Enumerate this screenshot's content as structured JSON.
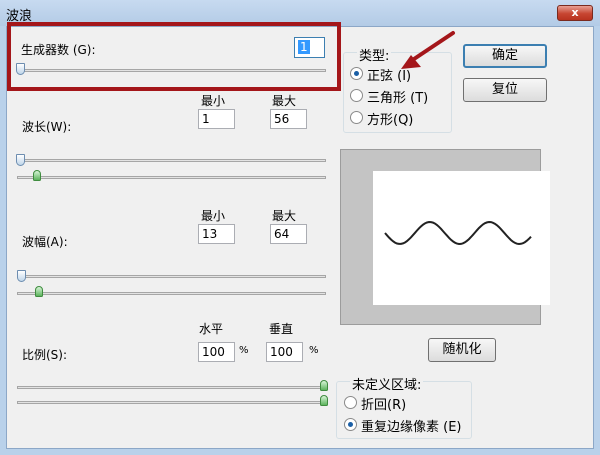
{
  "window": {
    "title": "波浪",
    "close_label": "x"
  },
  "generators": {
    "label": "生成器数 (G):",
    "value": "1"
  },
  "headers": {
    "min": "最小",
    "max": "最大",
    "horizontal": "水平",
    "vertical": "垂直"
  },
  "wavelength": {
    "label": "波长(W):",
    "min": "1",
    "max": "56"
  },
  "amplitude": {
    "label": "波幅(A):",
    "min": "13",
    "max": "64"
  },
  "scale": {
    "label": "比例(S):",
    "horizontal": "100",
    "vertical": "100",
    "percent": "%"
  },
  "type": {
    "label": "类型:",
    "options": [
      {
        "label": "正弦 (I)",
        "checked": true
      },
      {
        "label": "三角形 (T)",
        "checked": false
      },
      {
        "label": "方形(Q)",
        "checked": false
      }
    ]
  },
  "buttons": {
    "ok": "确定",
    "reset": "复位",
    "randomize": "随机化"
  },
  "undefined_area": {
    "label": "未定义区域:",
    "options": [
      {
        "label": "折回(R)",
        "checked": false
      },
      {
        "label": "重复边缘像素 (E)",
        "checked": true
      }
    ]
  },
  "colors": {
    "highlight": "#a4161a",
    "accent": "#3c7fb1"
  }
}
